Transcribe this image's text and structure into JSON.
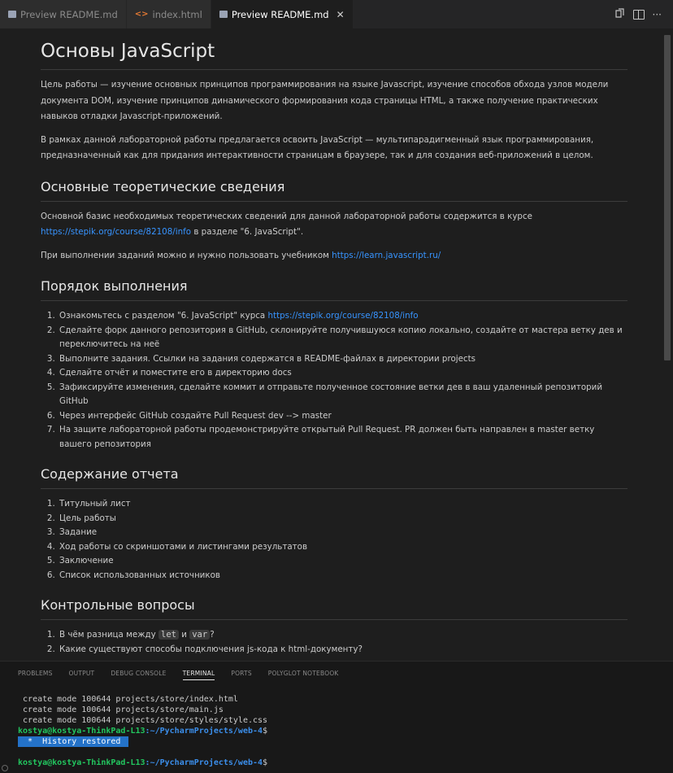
{
  "tabs": [
    {
      "label": "Preview README.md",
      "icon": "markdown-preview-icon",
      "active": false
    },
    {
      "label": "index.html",
      "icon": "html-file-icon",
      "active": false
    },
    {
      "label": "Preview README.md",
      "icon": "markdown-preview-icon",
      "active": true,
      "close": "✕"
    }
  ],
  "tab_actions": {
    "more": "···"
  },
  "doc": {
    "h1": "Основы JavaScript",
    "intro_p1": "Цель работы — изучение основных принципов программирования на языке Javascript, изучение способов обхода узлов модели документа DOM, изучение принципов динамического формирования кода страницы HTML, а также получение практических навыков отладки Javascript-приложений.",
    "intro_p2": "В рамках данной лабораторной работы предлагается освоить JavaScript — мультипарадигменный язык программирования, предназначенный как для придания интерактивности страницам в браузере, так и для создания веб-приложений в целом.",
    "theory_h2": "Основные теоретические сведения",
    "theory_p1_pre": "Основной базис необходимых теоретических сведений для данной лабораторной работы содержится в курсе",
    "theory_p1_link": "https://stepik.org/course/82108/info",
    "theory_p1_post": " в разделе \"6. JavaScript\".",
    "theory_p2_pre": "При выполнении заданий можно и нужно пользовать учебником ",
    "theory_p2_link": "https://learn.javascript.ru/",
    "order_h2": "Порядок выполнения",
    "order_items": [
      {
        "text": "Ознакомьтесь с разделом \"6. JavaScript\" курса ",
        "link": "https://stepik.org/course/82108/info"
      },
      {
        "text": "Сделайте форк данного репозитория в GitHub, склонируйте получившуюся копию локально, создайте от мастера ветку дев и переключитесь на неё"
      },
      {
        "text": "Выполните задания. Ссылки на задания содержатся в README-файлах в директории projects"
      },
      {
        "text": "Сделайте отчёт и поместите его в директорию docs"
      },
      {
        "text": "Зафиксируйте изменения, сделайте коммит и отправьте полученное состояние ветки дев в ваш удаленный репозиторий GitHub"
      },
      {
        "text": "Через интерфейс GitHub создайте Pull Request dev --> master"
      },
      {
        "text": "На защите лабораторной работы продемонстрируйте открытый Pull Request. PR должен быть направлен в master ветку вашего репозитория"
      }
    ],
    "report_h2": "Содержание отчета",
    "report_items": [
      "Титульный лист",
      "Цель работы",
      "Задание",
      "Ход работы со скриншотами и листингами результатов",
      "Заключение",
      "Список использованных источников"
    ],
    "questions_h2": "Контрольные вопросы",
    "q1_pre": "В чём разница между ",
    "q1_code1": "let",
    "q1_mid": " и ",
    "q1_code2": "var",
    "q1_post": "?",
    "q2": "Какие существуют способы подключения js-кода к html-документу?"
  },
  "panel": {
    "tabs": [
      "PROBLEMS",
      "OUTPUT",
      "DEBUG CONSOLE",
      "TERMINAL",
      "PORTS",
      "POLYGLOT NOTEBOOK"
    ],
    "active_tab": "TERMINAL"
  },
  "terminal": {
    "lines": [
      "create mode 100644 projects/store/index.html",
      "create mode 100644 projects/store/main.js",
      "create mode 100644 projects/store/styles/style.css"
    ],
    "user": "kostya@kostya-ThinkPad-L13",
    "path": ":~/PycharmProjects/web-4",
    "dollar": "$",
    "history_star": "*",
    "history": "History restored"
  },
  "colors": {
    "accent": "#3794ff",
    "terminal_user": "#22c55e",
    "terminal_path": "#3b8eea",
    "history_bg": "#2472c8"
  }
}
